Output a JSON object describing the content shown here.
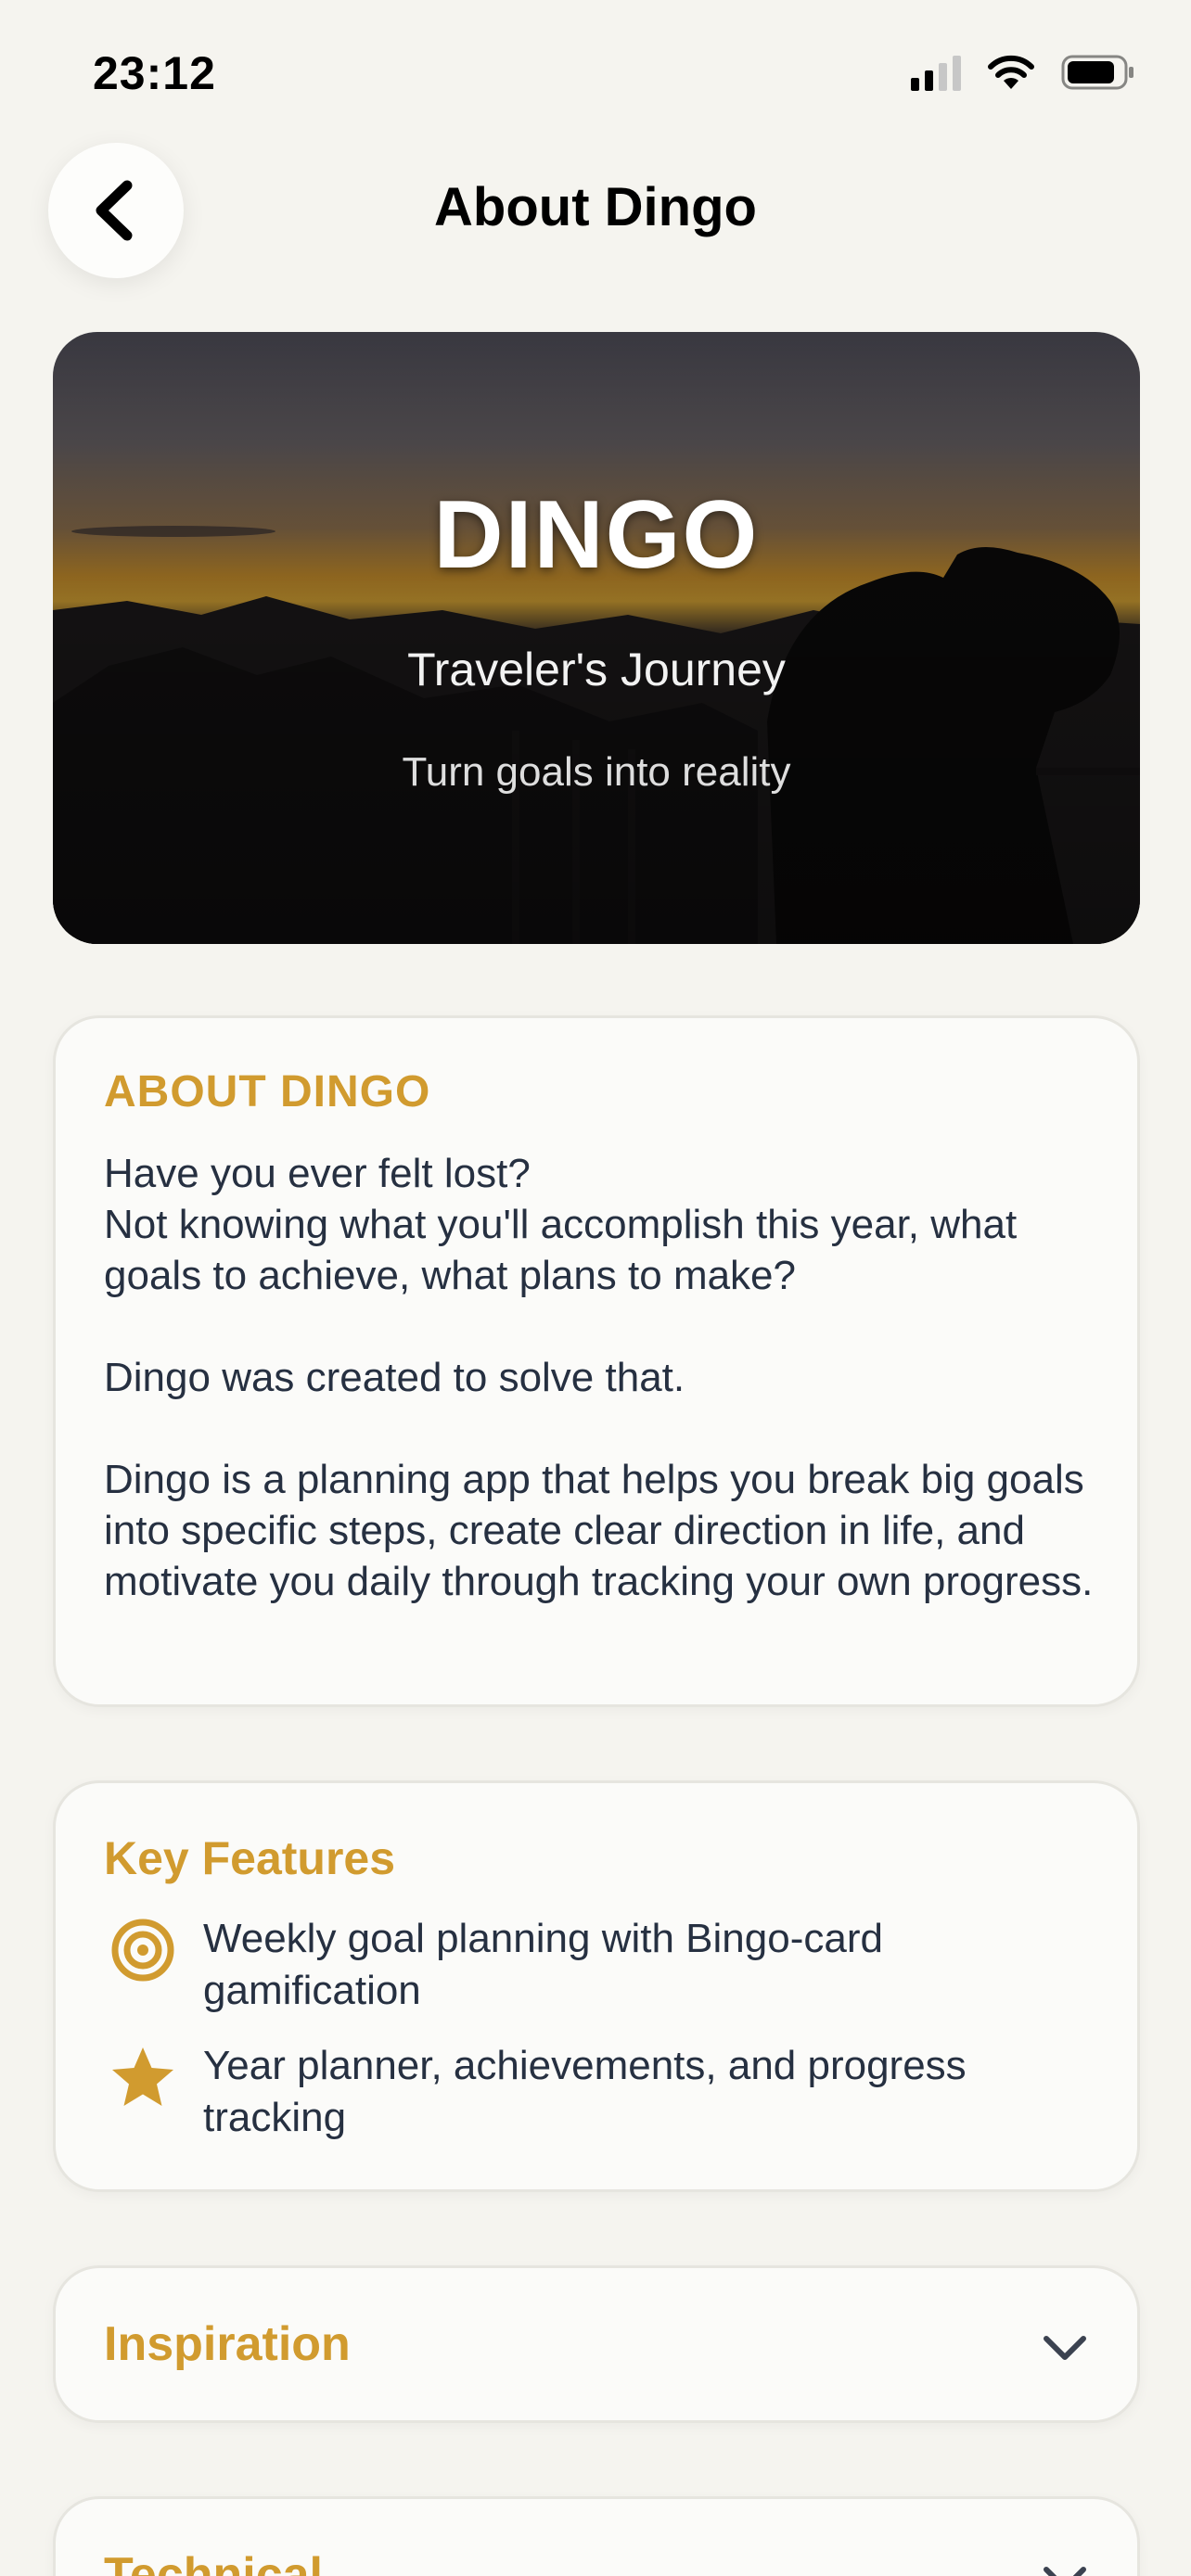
{
  "status_bar": {
    "time": "23:12"
  },
  "nav": {
    "title": "About Dingo",
    "back_icon": "chevron-left-icon"
  },
  "hero": {
    "title": "DINGO",
    "subtitle": "Traveler's Journey",
    "tagline": "Turn goals into reality"
  },
  "about": {
    "heading": "ABOUT DINGO",
    "body": "Have you ever felt lost?\nNot knowing what you'll accomplish this year, what goals to achieve, what plans to make?\n\nDingo was created to solve that.\n\nDingo is a planning app that helps you break big goals into specific steps, create clear direction in life, and motivate you daily through tracking your own progress."
  },
  "features": {
    "heading": "Key Features",
    "items": [
      {
        "icon": "target-icon",
        "text": "Weekly goal planning with Bingo-card gamification"
      },
      {
        "icon": "star-icon",
        "text": "Year planner, achievements, and progress tracking"
      }
    ]
  },
  "sections": [
    {
      "label": "Inspiration",
      "icon": "chevron-down-icon"
    },
    {
      "label": "Technical",
      "icon": "chevron-down-icon"
    }
  ],
  "colors": {
    "background": "#f5f4ef",
    "accent": "#d19b2f",
    "text": "#263041",
    "card": "#fbfbf9"
  }
}
